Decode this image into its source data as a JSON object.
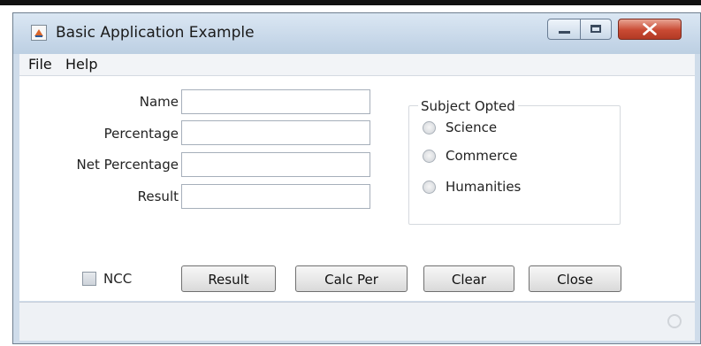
{
  "window": {
    "title": "Basic Application Example",
    "close_symbol": "X"
  },
  "menu": {
    "file": "File",
    "help": "Help"
  },
  "form": {
    "name_label": "Name",
    "name_value": "",
    "percentage_label": "Percentage",
    "percentage_value": "",
    "net_percentage_label": "Net Percentage",
    "net_percentage_value": "",
    "result_label": "Result",
    "result_value": ""
  },
  "subject_group": {
    "title": "Subject Opted",
    "options": [
      "Science",
      "Commerce",
      "Humanities"
    ],
    "selected": null
  },
  "ncc": {
    "label": "NCC",
    "checked": false
  },
  "buttons": {
    "result": "Result",
    "calc_per": "Calc Per",
    "clear": "Clear",
    "close": "Close"
  },
  "icons": [
    "app-icon",
    "minimize-icon",
    "maximize-icon",
    "close-icon",
    "busy-indicator-icon"
  ],
  "colors": {
    "titlebar": "#c5d6e8",
    "close_button": "#c94a33",
    "content_bg": "#ffffff"
  }
}
